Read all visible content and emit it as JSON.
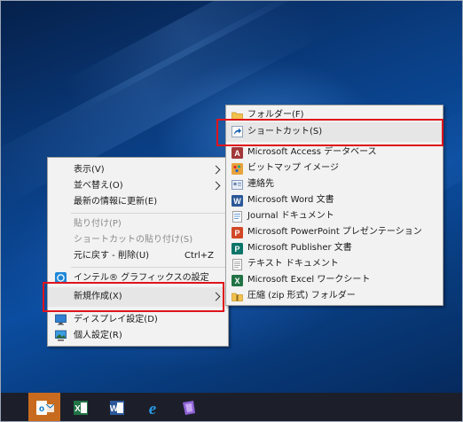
{
  "context_menu": {
    "items": [
      {
        "label": "表示(V)",
        "submenu": true
      },
      {
        "label": "並べ替え(O)",
        "submenu": true
      },
      {
        "label": "最新の情報に更新(E)"
      },
      {
        "label": "貼り付け(P)",
        "disabled": true
      },
      {
        "label": "ショートカットの貼り付け(S)",
        "disabled": true
      },
      {
        "label": "元に戻す - 削除(U)",
        "shortcut": "Ctrl+Z"
      },
      {
        "label": "インテル® グラフィックスの設定",
        "icon": "intel-graphics-icon"
      },
      {
        "label": "新規作成(X)",
        "submenu": true,
        "highlighted": true
      },
      {
        "label": "ディスプレイ設定(D)",
        "icon": "display-icon"
      },
      {
        "label": "個人設定(R)",
        "icon": "personalize-icon"
      }
    ]
  },
  "new_submenu": {
    "items": [
      {
        "label": "フォルダー(F)",
        "icon": "folder-icon"
      },
      {
        "label": "ショートカット(S)",
        "icon": "shortcut-icon",
        "highlighted": true
      },
      {
        "label": "Microsoft Access データベース",
        "icon": "access-icon"
      },
      {
        "label": "ビットマップ イメージ",
        "icon": "bitmap-icon"
      },
      {
        "label": "連絡先",
        "icon": "contact-icon"
      },
      {
        "label": "Microsoft Word 文書",
        "icon": "word-icon"
      },
      {
        "label": "Journal ドキュメント",
        "icon": "journal-icon"
      },
      {
        "label": "Microsoft PowerPoint プレゼンテーション",
        "icon": "powerpoint-icon"
      },
      {
        "label": "Microsoft Publisher 文書",
        "icon": "publisher-icon"
      },
      {
        "label": "テキスト ドキュメント",
        "icon": "text-document-icon"
      },
      {
        "label": "Microsoft Excel ワークシート",
        "icon": "excel-icon"
      },
      {
        "label": "圧縮 (zip 形式) フォルダー",
        "icon": "zip-folder-icon"
      }
    ]
  },
  "taskbar": {
    "apps": [
      "outlook-icon",
      "excel-icon",
      "word-icon",
      "edge-icon",
      "visual-studio-icon"
    ]
  },
  "colors": {
    "callout_red": "#e0141b",
    "menu_bg": "#f2f2f2",
    "taskbar_bg": "#1c1f2a"
  }
}
